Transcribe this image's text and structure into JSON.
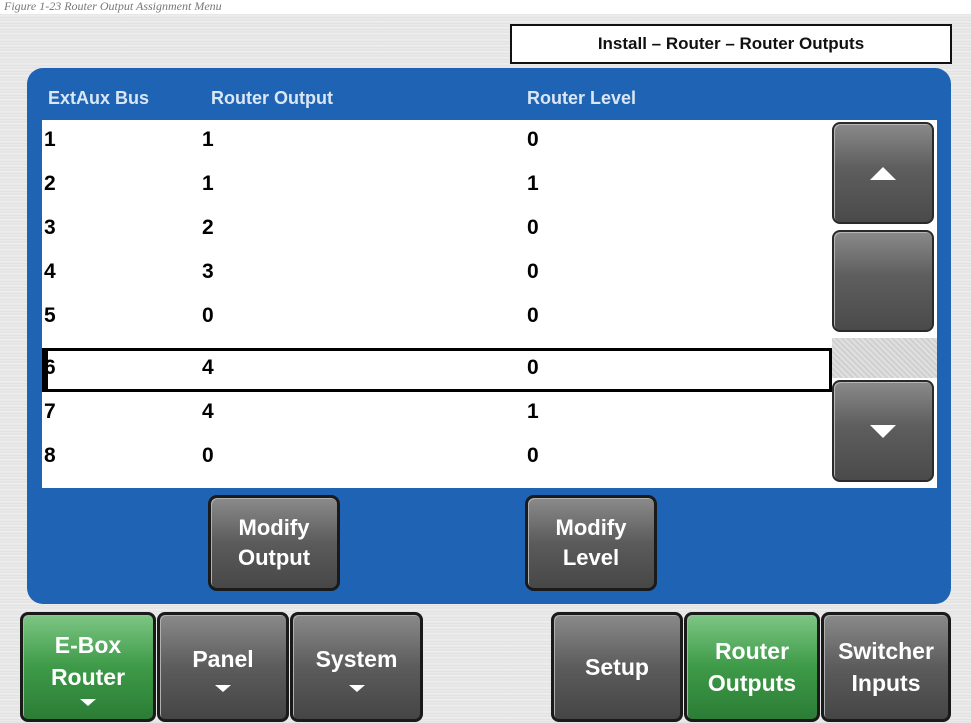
{
  "caption": "Figure 1-23 Router Output Assignment Menu",
  "header": {
    "breadcrumb": "Install – Router – Router Outputs"
  },
  "table": {
    "columns": [
      "ExtAux Bus",
      "Router Output",
      "Router Level"
    ],
    "rows": [
      {
        "bus": "1",
        "output": "1",
        "level": "0"
      },
      {
        "bus": "2",
        "output": "1",
        "level": "1"
      },
      {
        "bus": "3",
        "output": "2",
        "level": "0"
      },
      {
        "bus": "4",
        "output": "3",
        "level": "0"
      },
      {
        "bus": "5",
        "output": "0",
        "level": "0"
      },
      {
        "bus": "6",
        "output": "4",
        "level": "0"
      },
      {
        "bus": "7",
        "output": "4",
        "level": "1"
      },
      {
        "bus": "8",
        "output": "0",
        "level": "0"
      }
    ],
    "selected_row_index": 5
  },
  "scroll": {
    "up_icon": "triangle-up",
    "down_icon": "triangle-down"
  },
  "actions": {
    "modify_output": {
      "line1": "Modify",
      "line2": "Output"
    },
    "modify_level": {
      "line1": "Modify",
      "line2": "Level"
    }
  },
  "menu": {
    "ebox_router": {
      "line1": "E-Box",
      "line2": "Router",
      "active": true
    },
    "panel": {
      "label": "Panel"
    },
    "system": {
      "label": "System"
    },
    "setup": {
      "label": "Setup"
    },
    "router_outputs": {
      "line1": "Router",
      "line2": "Outputs",
      "active": true
    },
    "switcher_inputs": {
      "line1": "Switcher",
      "line2": "Inputs"
    }
  },
  "colors": {
    "panel_blue": "#1f64b4",
    "active_green": "#3d9a47",
    "button_gray": "#5c5c5c"
  }
}
